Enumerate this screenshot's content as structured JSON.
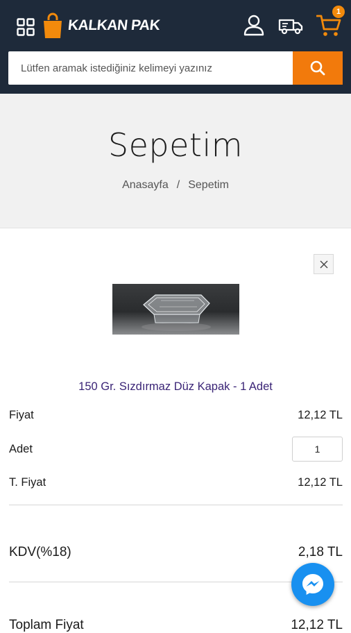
{
  "header": {
    "brand": "KALKAN PAK",
    "cart_count": "1"
  },
  "search": {
    "placeholder": "Lütfen aramak istediğiniz kelimeyi yazınız"
  },
  "page": {
    "title": "Sepetim",
    "breadcrumb": [
      "Anasayfa",
      "/",
      "Sepetim"
    ]
  },
  "cart": {
    "product_name": "150 Gr. Sızdırmaz Düz Kapak - 1 Adet",
    "price_label": "Fiyat",
    "price_value": "12,12 TL",
    "qty_label": "Adet",
    "qty_value": "1",
    "total_label": "T. Fiyat",
    "total_value": "12,12 TL",
    "tax_label": "KDV(%18)",
    "tax_value": "2,18 TL",
    "grand_label": "Toplam Fiyat",
    "grand_value": "12,12 TL"
  },
  "colors": {
    "header_bg": "#1e2a3a",
    "accent": "#f27a0c",
    "product_link": "#3a2476",
    "messenger": "#1890f0"
  },
  "icons": [
    "grid-menu-icon",
    "shopping-bag-logo-icon",
    "user-icon",
    "shipping-truck-icon",
    "cart-icon",
    "search-icon",
    "close-icon",
    "messenger-icon"
  ]
}
